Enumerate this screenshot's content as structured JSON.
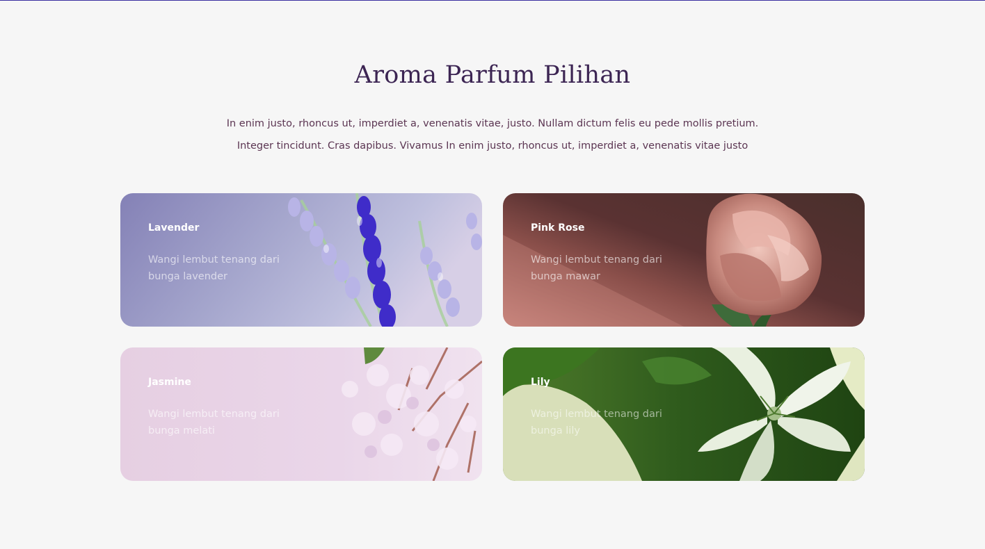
{
  "heading": {
    "title": "Aroma Parfum Pilihan",
    "description_line1": "In enim justo, rhoncus ut, imperdiet a, venenatis vitae, justo. Nullam dictum felis eu pede mollis pretium.",
    "description_line2": "Integer tincidunt. Cras dapibus. Vivamus In enim justo, rhoncus ut, imperdiet a, venenatis vitae justo"
  },
  "cards": [
    {
      "name": "Lavender",
      "text": "Wangi lembut tenang dari bunga lavender",
      "image": "lavender-flowers",
      "color": "#8a86b8"
    },
    {
      "name": "Pink Rose",
      "text": "Wangi lembut tenang dari bunga mawar",
      "image": "pink-rose",
      "color": "#4e2f2c"
    },
    {
      "name": "Jasmine",
      "text": "Wangi lembut tenang dari bunga melati",
      "image": "jasmine-flowers",
      "color": "#e6d0e4"
    },
    {
      "name": "Lily",
      "text": "Wangi lembut tenang dari bunga lily",
      "image": "white-lily",
      "color": "#234a14"
    }
  ],
  "colors": {
    "background": "#f6f6f6",
    "title": "#3c2553",
    "description": "#5b3552",
    "top_border": "#3a2fa0"
  }
}
